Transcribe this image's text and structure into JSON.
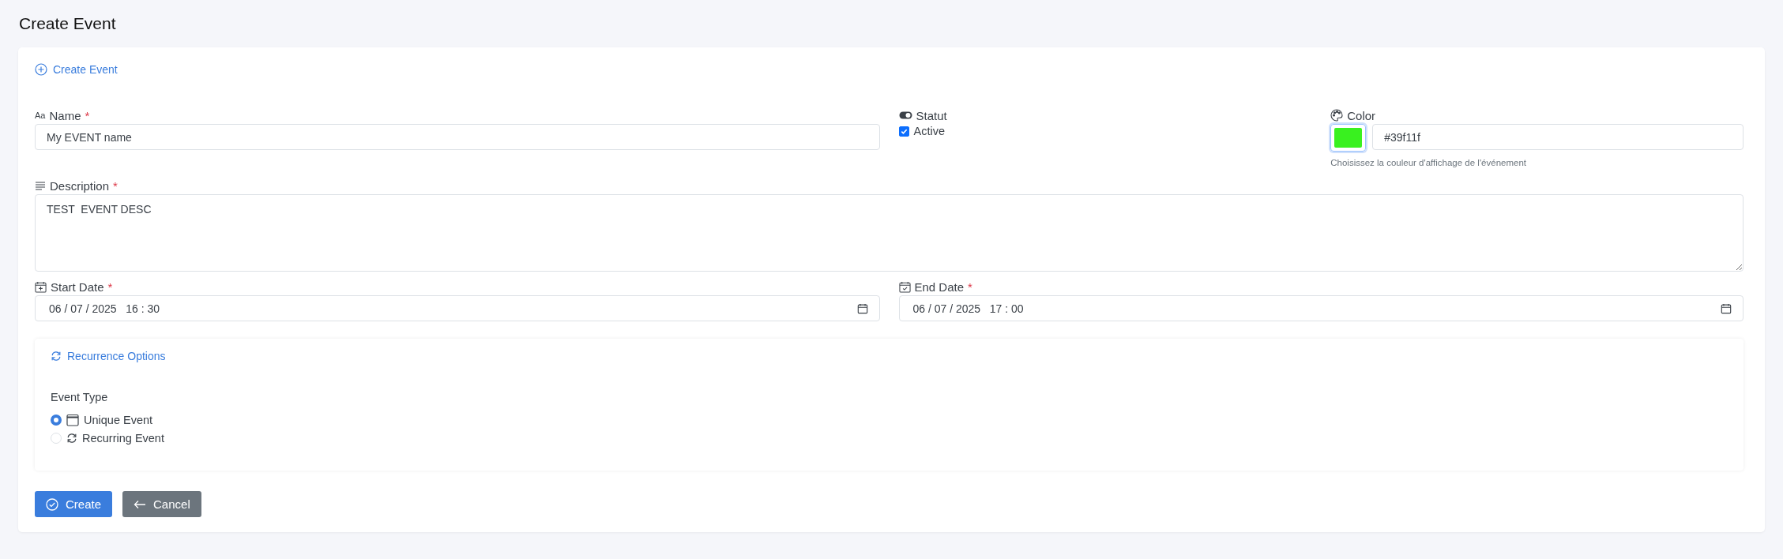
{
  "page_title": "Create Event",
  "card": {
    "header": "Create Event"
  },
  "name": {
    "icon_text": "Aa",
    "label": "Name",
    "required_mark": "*",
    "value": "My EVENT name"
  },
  "status": {
    "label": "Statut",
    "checkbox": {
      "label": "Active",
      "checked": true
    }
  },
  "color": {
    "label": "Color",
    "value": "#39f11f",
    "hint": "Choisissez la couleur d'affichage de l'événement"
  },
  "description": {
    "label": "Description",
    "required_mark": "*",
    "value": "TEST  EVENT DESC"
  },
  "start_date": {
    "label": "Start Date",
    "required_mark": "*",
    "value": "06 / 07 / 2025   16 : 30"
  },
  "end_date": {
    "label": "End Date",
    "required_mark": "*",
    "value": "06 / 07 / 2025   17 : 00"
  },
  "recurrence": {
    "header": "Recurrence Options",
    "event_type_label": "Event Type",
    "options": [
      {
        "label": "Unique Event",
        "kind": "unique",
        "selected": true
      },
      {
        "label": "Recurring Event",
        "kind": "recurring",
        "selected": false
      }
    ]
  },
  "buttons": [
    {
      "label": "Create",
      "kind": "primary"
    },
    {
      "label": "Cancel",
      "kind": "secondary"
    }
  ]
}
